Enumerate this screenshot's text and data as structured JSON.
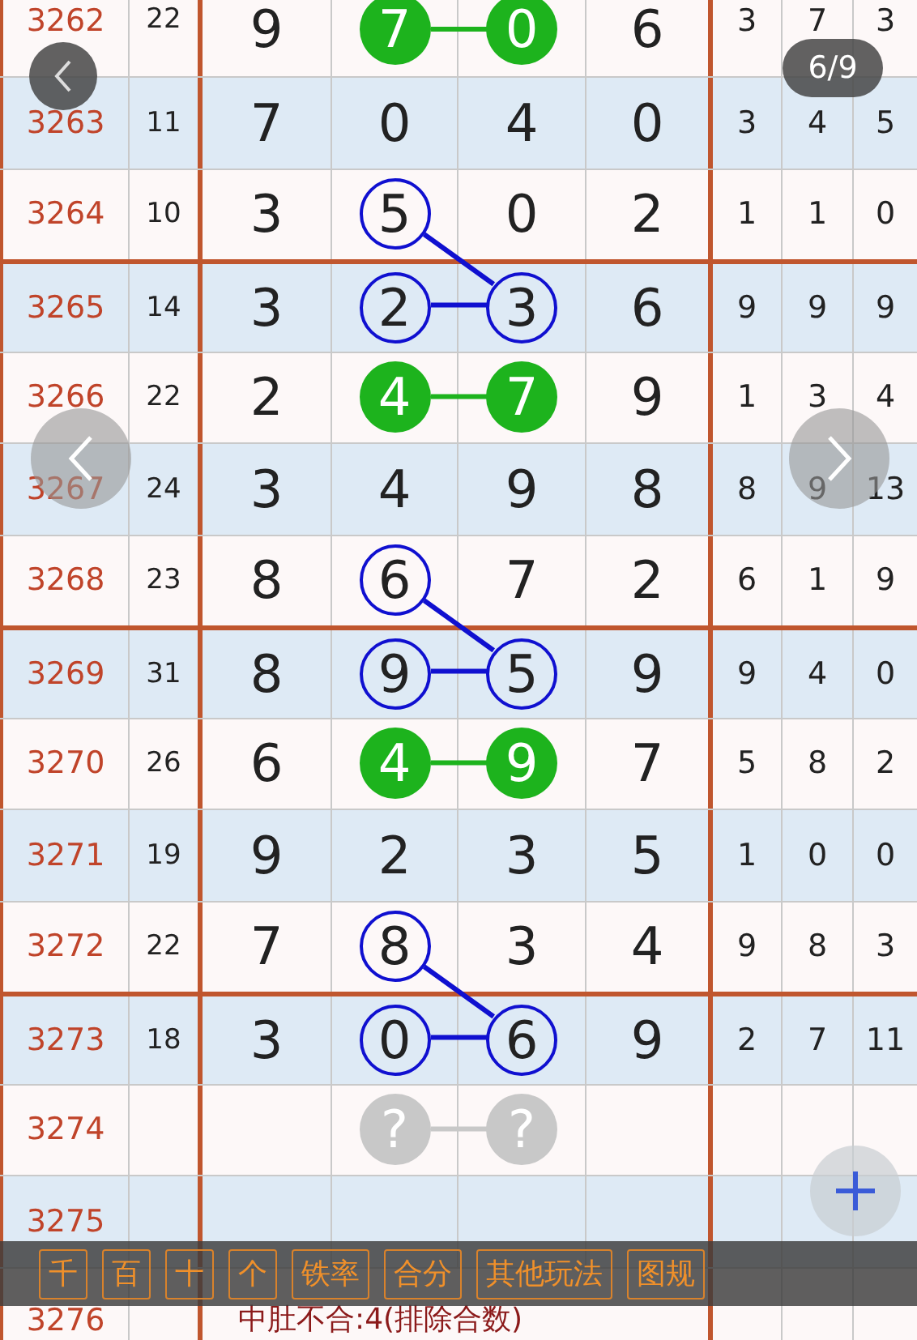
{
  "viewer": {
    "counter": "6/9"
  },
  "rows": [
    {
      "issue": "3262",
      "sum": "22",
      "section_start": false,
      "digits": [
        {
          "value": "9",
          "kind": "plain"
        },
        {
          "value": "7",
          "kind": "hit"
        },
        {
          "value": "0",
          "kind": "hit"
        },
        {
          "value": "6",
          "kind": "plain"
        }
      ],
      "extra": [
        "3",
        "7",
        "3"
      ]
    },
    {
      "issue": "3263",
      "sum": "11",
      "section_start": false,
      "digits": [
        {
          "value": "7",
          "kind": "plain"
        },
        {
          "value": "0",
          "kind": "plain"
        },
        {
          "value": "4",
          "kind": "plain"
        },
        {
          "value": "0",
          "kind": "plain"
        }
      ],
      "extra": [
        "3",
        "4",
        "5"
      ]
    },
    {
      "issue": "3264",
      "sum": "10",
      "section_start": false,
      "digits": [
        {
          "value": "3",
          "kind": "plain"
        },
        {
          "value": "5",
          "kind": "circled"
        },
        {
          "value": "0",
          "kind": "plain"
        },
        {
          "value": "2",
          "kind": "plain"
        }
      ],
      "extra": [
        "1",
        "1",
        "0"
      ]
    },
    {
      "issue": "3265",
      "sum": "14",
      "section_start": true,
      "digits": [
        {
          "value": "3",
          "kind": "plain"
        },
        {
          "value": "2",
          "kind": "circled"
        },
        {
          "value": "3",
          "kind": "circled"
        },
        {
          "value": "6",
          "kind": "plain"
        }
      ],
      "extra": [
        "9",
        "9",
        "9"
      ]
    },
    {
      "issue": "3266",
      "sum": "22",
      "section_start": false,
      "digits": [
        {
          "value": "2",
          "kind": "plain"
        },
        {
          "value": "4",
          "kind": "hit"
        },
        {
          "value": "7",
          "kind": "hit"
        },
        {
          "value": "9",
          "kind": "plain"
        }
      ],
      "extra": [
        "1",
        "3",
        "4"
      ]
    },
    {
      "issue": "3267",
      "sum": "24",
      "section_start": false,
      "digits": [
        {
          "value": "3",
          "kind": "plain"
        },
        {
          "value": "4",
          "kind": "plain"
        },
        {
          "value": "9",
          "kind": "plain"
        },
        {
          "value": "8",
          "kind": "plain"
        }
      ],
      "extra": [
        "8",
        "9",
        "13"
      ]
    },
    {
      "issue": "3268",
      "sum": "23",
      "section_start": false,
      "digits": [
        {
          "value": "8",
          "kind": "plain"
        },
        {
          "value": "6",
          "kind": "circled"
        },
        {
          "value": "7",
          "kind": "plain"
        },
        {
          "value": "2",
          "kind": "plain"
        }
      ],
      "extra": [
        "6",
        "1",
        "9"
      ]
    },
    {
      "issue": "3269",
      "sum": "31",
      "section_start": true,
      "digits": [
        {
          "value": "8",
          "kind": "plain"
        },
        {
          "value": "9",
          "kind": "circled"
        },
        {
          "value": "5",
          "kind": "circled"
        },
        {
          "value": "9",
          "kind": "plain"
        }
      ],
      "extra": [
        "9",
        "4",
        "0"
      ]
    },
    {
      "issue": "3270",
      "sum": "26",
      "section_start": false,
      "digits": [
        {
          "value": "6",
          "kind": "plain"
        },
        {
          "value": "4",
          "kind": "hit"
        },
        {
          "value": "9",
          "kind": "hit"
        },
        {
          "value": "7",
          "kind": "plain"
        }
      ],
      "extra": [
        "5",
        "8",
        "2"
      ]
    },
    {
      "issue": "3271",
      "sum": "19",
      "section_start": false,
      "digits": [
        {
          "value": "9",
          "kind": "plain"
        },
        {
          "value": "2",
          "kind": "plain"
        },
        {
          "value": "3",
          "kind": "plain"
        },
        {
          "value": "5",
          "kind": "plain"
        }
      ],
      "extra": [
        "1",
        "0",
        "0"
      ]
    },
    {
      "issue": "3272",
      "sum": "22",
      "section_start": false,
      "digits": [
        {
          "value": "7",
          "kind": "plain"
        },
        {
          "value": "8",
          "kind": "circled"
        },
        {
          "value": "3",
          "kind": "plain"
        },
        {
          "value": "4",
          "kind": "plain"
        }
      ],
      "extra": [
        "9",
        "8",
        "3"
      ]
    },
    {
      "issue": "3273",
      "sum": "18",
      "section_start": true,
      "digits": [
        {
          "value": "3",
          "kind": "plain"
        },
        {
          "value": "0",
          "kind": "circled"
        },
        {
          "value": "6",
          "kind": "circled"
        },
        {
          "value": "9",
          "kind": "plain"
        }
      ],
      "extra": [
        "2",
        "7",
        "11"
      ]
    },
    {
      "issue": "3274",
      "section_start": false,
      "digits": [
        {
          "kind": "plain"
        },
        {
          "value": "?",
          "kind": "unknown"
        },
        {
          "value": "?",
          "kind": "unknown"
        },
        {
          "kind": "plain"
        }
      ]
    },
    {
      "issue": "3275",
      "section_start": false
    },
    {
      "issue": "3276",
      "section_start": false,
      "note": "中肚不合:4(排除合数)"
    }
  ],
  "toolbar": [
    "千",
    "百",
    "十",
    "个",
    "铁率",
    "合分",
    "其他玩法",
    "图规"
  ]
}
